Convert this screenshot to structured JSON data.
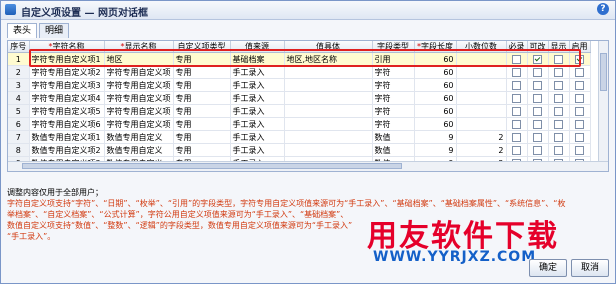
{
  "window": {
    "title": "自定义项设置 — 网页对话框",
    "help_icon": "?"
  },
  "tabs": [
    {
      "label": "表头",
      "active": true
    },
    {
      "label": "明细",
      "active": false
    }
  ],
  "grid": {
    "columns": [
      {
        "label": "序号",
        "required": false
      },
      {
        "label": "字符名称",
        "required": true
      },
      {
        "label": "显示名称",
        "required": true
      },
      {
        "label": "自定义项类型",
        "required": false
      },
      {
        "label": "值来源",
        "required": false
      },
      {
        "label": "值具体",
        "required": false
      },
      {
        "label": "字段类型",
        "required": false
      },
      {
        "label": "字段长度",
        "required": true
      },
      {
        "label": "小数位数",
        "required": false
      },
      {
        "label": "必录",
        "required": false
      },
      {
        "label": "可改",
        "required": false
      },
      {
        "label": "显示",
        "required": false
      },
      {
        "label": "启用",
        "required": false
      }
    ],
    "rows": [
      {
        "idx": "1",
        "name": "字符专用自定义项1",
        "display": "地区",
        "type": "专用",
        "source": "基础档案",
        "detail": "地区,地区名称",
        "ftype": "引用",
        "len": "60",
        "dec": "",
        "must": false,
        "edit": true,
        "show": false,
        "on": true
      },
      {
        "idx": "2",
        "name": "字符专用自定义项2",
        "display": "字符专用自定义项",
        "type": "专用",
        "source": "手工录入",
        "detail": "",
        "ftype": "字符",
        "len": "60",
        "dec": "",
        "must": false,
        "edit": false,
        "show": false,
        "on": false
      },
      {
        "idx": "3",
        "name": "字符专用自定义项3",
        "display": "字符专用自定义项",
        "type": "专用",
        "source": "手工录入",
        "detail": "",
        "ftype": "字符",
        "len": "60",
        "dec": "",
        "must": false,
        "edit": false,
        "show": false,
        "on": false
      },
      {
        "idx": "4",
        "name": "字符专用自定义项4",
        "display": "字符专用自定义项",
        "type": "专用",
        "source": "手工录入",
        "detail": "",
        "ftype": "字符",
        "len": "60",
        "dec": "",
        "must": false,
        "edit": false,
        "show": false,
        "on": false
      },
      {
        "idx": "5",
        "name": "字符专用自定义项5",
        "display": "字符专用自定义项",
        "type": "专用",
        "source": "手工录入",
        "detail": "",
        "ftype": "字符",
        "len": "60",
        "dec": "",
        "must": false,
        "edit": false,
        "show": false,
        "on": false
      },
      {
        "idx": "6",
        "name": "字符专用自定义项6",
        "display": "字符专用自定义项",
        "type": "专用",
        "source": "手工录入",
        "detail": "",
        "ftype": "字符",
        "len": "60",
        "dec": "",
        "must": false,
        "edit": false,
        "show": false,
        "on": false
      },
      {
        "idx": "7",
        "name": "数值专用自定义项1",
        "display": "数值专用自定义",
        "type": "专用",
        "source": "手工录入",
        "detail": "",
        "ftype": "数值",
        "len": "9",
        "dec": "2",
        "must": false,
        "edit": false,
        "show": false,
        "on": false
      },
      {
        "idx": "8",
        "name": "数值专用自定义项2",
        "display": "数值专用自定义",
        "type": "专用",
        "source": "手工录入",
        "detail": "",
        "ftype": "数值",
        "len": "9",
        "dec": "2",
        "must": false,
        "edit": false,
        "show": false,
        "on": false
      },
      {
        "idx": "9",
        "name": "数值专用自定义项3",
        "display": "数值专用自定义",
        "type": "专用",
        "source": "手工录入",
        "detail": "",
        "ftype": "数值",
        "len": "9",
        "dec": "2",
        "must": false,
        "edit": false,
        "show": false,
        "on": false
      }
    ]
  },
  "notes": {
    "head": "调整内容仅用于全部用户；",
    "line1": "字符自定义项支持“字符”、“日期”、“枚举”、“引用”的字段类型，字符专用自定义项值来源可为“手工录入”、“基础档案”、“基础档案属性”、“系统信息”、“枚",
    "line2": "举档案”、“自定义档案”、“公式计算”，字符公用自定义项值来源可为“手工录入”、“基础档案”、",
    "line3": "数值自定义项支持“数值”、“整数”、“逻辑”的字段类型，数值专用自定义项值来源可为“手工录入”",
    "line4": "“手工录入”。"
  },
  "watermark": {
    "text": "用友软件下载",
    "url": "WWW.YYRJXZ.COM"
  },
  "buttons": {
    "ok": "确定",
    "cancel": "取消"
  },
  "colors": {
    "highlight_border": "#e02020",
    "note_text": "#d23a10",
    "watermark_red": "#e5002a",
    "watermark_blue": "#1460c8"
  }
}
